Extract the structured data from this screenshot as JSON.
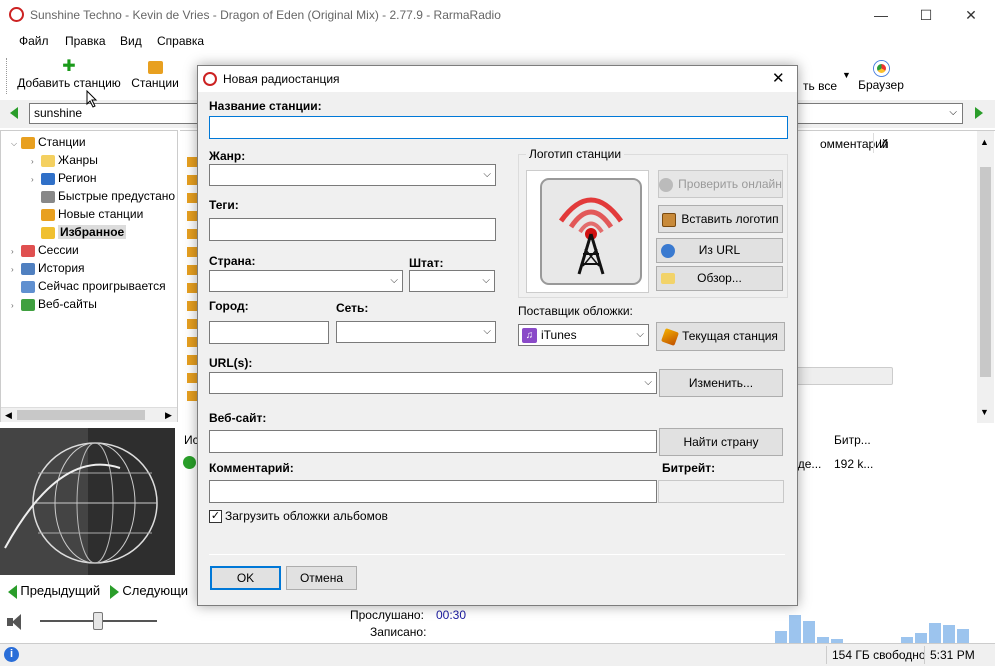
{
  "window": {
    "title": "Sunshine Techno - Kevin de Vries - Dragon of Eden (Original Mix) - 2.77.9 - RarmaRadio"
  },
  "menu": [
    "Файл",
    "Правка",
    "Вид",
    "Справка"
  ],
  "toolbar": {
    "add_station": "Добавить станцию",
    "stations": "Станции",
    "stop_all": "ть все",
    "browser": "Браузер"
  },
  "address": {
    "value": "sunshine"
  },
  "tree": {
    "items": [
      {
        "label": "Станции",
        "indent": 0,
        "color": "#e8a020"
      },
      {
        "label": "Жанры",
        "indent": 1,
        "color": "#f4d060"
      },
      {
        "label": "Регион",
        "indent": 1,
        "color": "#3070c8"
      },
      {
        "label": "Быстрые предустано",
        "indent": 1,
        "color": "#888888"
      },
      {
        "label": "Новые станции",
        "indent": 1,
        "color": "#e8a020"
      },
      {
        "label": "Избранное",
        "indent": 1,
        "color": "#f0c030",
        "selected": true
      },
      {
        "label": "Сессии",
        "indent": 0,
        "color": "#e05050"
      },
      {
        "label": "История",
        "indent": 0,
        "color": "#5080c0"
      },
      {
        "label": "Сейчас проигрывается",
        "indent": 0,
        "color": "#6090d0"
      },
      {
        "label": "Веб-сайты",
        "indent": 0,
        "color": "#40a040"
      }
    ]
  },
  "list_columns": {
    "comment": "омментарий",
    "c2": "И"
  },
  "bottom_list": {
    "col_bitrate": "Битр...",
    "col_ide": "иде...",
    "bitrate_val": "192 k...",
    "col_is": "Ис"
  },
  "player": {
    "prev": "Предыдущий",
    "next": "Следующи",
    "listened_label": "Прослушано:",
    "listened_value": "00:30",
    "recorded_label": "Записано:"
  },
  "status": {
    "free": "154 ГБ свободно",
    "time": "5:31 PM"
  },
  "dialog": {
    "title": "Новая радиостанция",
    "station_name_label": "Название станции:",
    "station_name_value": "",
    "genre_label": "Жанр:",
    "tags_label": "Теги:",
    "country_label": "Страна:",
    "state_label": "Штат:",
    "city_label": "Город:",
    "network_label": "Сеть:",
    "urls_label": "URL(s):",
    "change_button": "Изменить...",
    "website_label": "Веб-сайт:",
    "find_country_button": "Найти страну",
    "comment_label": "Комментарий:",
    "bitrate_label": "Битрейт:",
    "load_covers_label": "Загрузить обложки альбомов",
    "load_covers_checked": true,
    "logo_group": "Логотип станции",
    "check_online_button": "Проверить онлайн",
    "paste_logo_button": "Вставить логотип",
    "from_url_button": "Из URL",
    "browse_button": "Обзор...",
    "cover_provider_label": "Поставщик обложки:",
    "cover_provider_value": "iTunes",
    "current_station_button": "Текущая станция",
    "ok_button": "OK",
    "cancel_button": "Отмена"
  },
  "colors": {
    "accent": "#0078d7",
    "logo_red": "#e01b1b",
    "time_blue": "#1a1aa0"
  }
}
